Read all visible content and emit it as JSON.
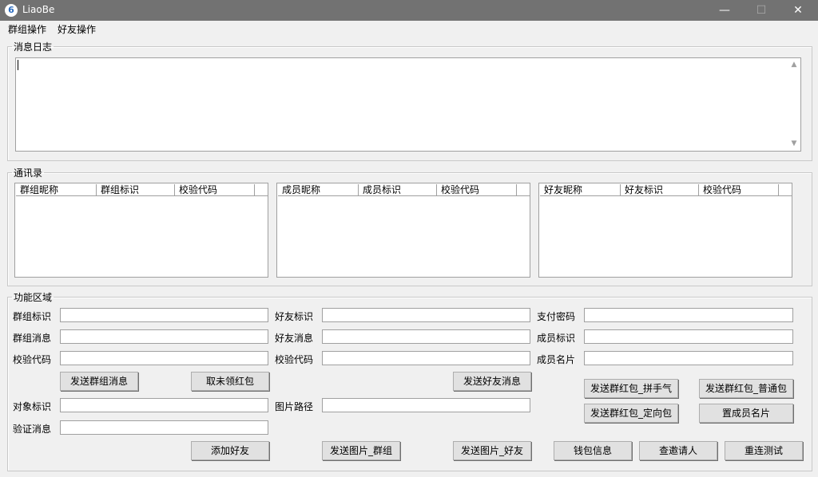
{
  "window": {
    "app_icon_glyph": "6",
    "title": "LiaoBe",
    "minimize_glyph": "—",
    "maximize_glyph": "☐",
    "close_glyph": "✕"
  },
  "menu": {
    "items": [
      "群组操作",
      "好友操作"
    ]
  },
  "log": {
    "legend": "消息日志",
    "content": "",
    "scroll_up_glyph": "▲",
    "scroll_down_glyph": "▼"
  },
  "contacts": {
    "legend": "通讯录",
    "groups_columns": [
      "群组昵称",
      "群组标识",
      "校验代码"
    ],
    "members_columns": [
      "成员昵称",
      "成员标识",
      "校验代码"
    ],
    "friends_columns": [
      "好友昵称",
      "好友标识",
      "校验代码"
    ]
  },
  "functions": {
    "legend": "功能区域",
    "labels": {
      "group_id": "群组标识",
      "group_message": "群组消息",
      "group_check_code": "校验代码",
      "friend_id": "好友标识",
      "friend_message": "好友消息",
      "friend_check_code": "校验代码",
      "pay_password": "支付密码",
      "member_id": "成员标识",
      "member_card": "成员名片",
      "target_id": "对象标识",
      "image_path": "图片路径",
      "verify_message": "验证消息"
    },
    "buttons": {
      "send_group_message": "发送群组消息",
      "get_unclaimed_red_packet": "取未领红包",
      "send_friend_message": "发送好友消息",
      "send_group_red_packet_lucky": "发送群红包_拼手气",
      "send_group_red_packet_normal": "发送群红包_普通包",
      "send_group_red_packet_directed": "发送群红包_定向包",
      "set_member_card": "置成员名片",
      "add_friend": "添加好友",
      "send_image_group": "发送图片_群组",
      "send_image_friend": "发送图片_好友",
      "wallet_info": "钱包信息",
      "query_inviter": "查邀请人",
      "reconnect_test": "重连测试"
    }
  }
}
